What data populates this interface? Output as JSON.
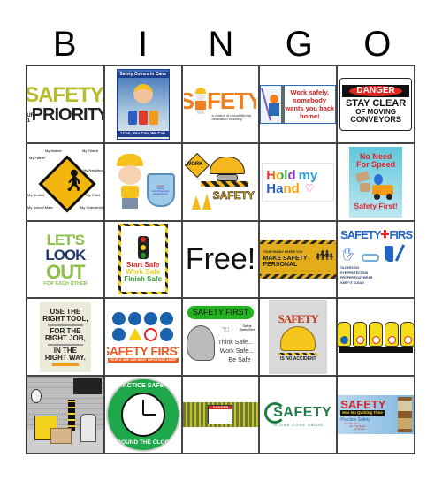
{
  "header": {
    "letters": [
      "B",
      "I",
      "N",
      "G",
      "O"
    ]
  },
  "cells": [
    {
      "id": "safety-our-1-priority",
      "line1": "SAFETY,",
      "prefix": "OUR #1",
      "line2": "PRIORITY",
      "colors": {
        "primary": "#b7bd2a",
        "secondary": "#222222"
      }
    },
    {
      "id": "safety-comes-in-cans",
      "title": "Safety Comes in Cans",
      "caption": "I Can, You Can, We Can",
      "can_labels": [
        "I Can",
        "You Can",
        "We Can"
      ],
      "colors": {
        "bg": "#1d3f8c",
        "accent": "#e03a2d"
      }
    },
    {
      "id": "safety-culture",
      "word_prefix": "S",
      "word_suffix": "FETY",
      "caption": "a culture of unconditional dedication to safety",
      "colors": {
        "primary": "#f07f1e"
      }
    },
    {
      "id": "work-safely-home",
      "text": "Work safely, somebody wants you back home!",
      "colors": {
        "text": "#cc1f1f",
        "border": "#2b6cb8"
      }
    },
    {
      "id": "danger-conveyors",
      "badge": "DANGER",
      "line1": "STAY CLEAR",
      "line2": "OF MOVING",
      "line3": "CONVEYORS",
      "colors": {
        "badge": "#e0241f"
      }
    },
    {
      "id": "pedestrian-sign",
      "labels": [
        "My Mother",
        "My Friend",
        "My Father",
        "My Neighbor",
        "My Brother",
        "My Child",
        "My School Mate",
        "My Grandchild"
      ],
      "colors": {
        "sign": "#f5b50f"
      }
    },
    {
      "id": "worker-shield",
      "shield_lines": [
        "Health",
        "Safety",
        "Fire Protection",
        "Engineering"
      ],
      "colors": {
        "helmet": "#f5c21b",
        "shield": "#9ecbe8"
      }
    },
    {
      "id": "work-safety-barrier",
      "sign": "WORK",
      "word": "SAFETY",
      "colors": {
        "yellow": "#f4b81c"
      }
    },
    {
      "id": "hold-my-hand",
      "line1_a": "Hold",
      "line1_b": "my",
      "line2": "Hand"
    },
    {
      "id": "no-need-for-speed",
      "line1": "No Need",
      "line2": "For Speed",
      "footer": "Safety First!",
      "colors": {
        "bg": "#5ec8db",
        "text": "#e0242b"
      }
    },
    {
      "id": "lets-look-out",
      "line1": "LET'S",
      "line2": "LOOK",
      "line3": "OUT",
      "line4": "FOR EACH OTHER",
      "colors": {
        "green": "#8cc04b",
        "navy": "#1f3a6b"
      }
    },
    {
      "id": "start-work-finish-safe",
      "line1": "Start Safe",
      "line2": "Work Safe",
      "line3": "Finish Safe",
      "colors": {
        "red": "#e0241f",
        "yellow": "#e0cf1b",
        "green": "#2e9a2e"
      }
    },
    {
      "id": "free-space",
      "label": "Free!"
    },
    {
      "id": "make-safety-personal",
      "small": "YOUR FAMILY NEEDS YOU",
      "line1": "MAKE SAFETY",
      "line2": "PERSONAL",
      "colors": {
        "bg": "#e2ac1b"
      }
    },
    {
      "id": "safety-first-ppe",
      "title_a": "SAFETY",
      "title_b": "FIRST.",
      "items": [
        "GLOVES ON",
        "EYE PROTECTION",
        "PROPER FOOTWEAR",
        "KEEP IT CLEAN"
      ],
      "colors": {
        "blue": "#1f64c2",
        "cross": "#e0241f"
      }
    },
    {
      "id": "right-tool-right-job",
      "line1": "USE THE",
      "line2": "RIGHT TOOL,",
      "line3": "FOR THE",
      "line4": "RIGHT JOB,",
      "line5": "IN THE",
      "line6": "RIGHT WAY.",
      "colors": {
        "bg": "#ecebd9"
      }
    },
    {
      "id": "safety-first-people",
      "title": "SAFETY FIRST",
      "banner": "PEOPLE ARE OUR MOST IMPORTANT ASSET",
      "colors": {
        "blue": "#1a62ad",
        "orange": "#f05a1e"
      }
    },
    {
      "id": "think-work-be-safe",
      "title": "SAFETY FIRST",
      "side": "Safety Starts Here",
      "line1": "Think Safe...",
      "line2": "Work Safe...",
      "line3": "Be Safe",
      "colors": {
        "pill": "#22b41f"
      }
    },
    {
      "id": "safety-no-accident",
      "word": "SAFETY",
      "caption": "IS NO ACCIDENT",
      "colors": {
        "bg": "#d9d9d9",
        "helmet": "#f5c61b"
      }
    },
    {
      "id": "stop-hands",
      "count": 5,
      "colors": {
        "hand": "#f5dd1b"
      }
    },
    {
      "id": "warehouse-forklift",
      "colors": {
        "forklift": "#f2d21b",
        "bg": "#cfcfcf"
      }
    },
    {
      "id": "practice-safety-clock",
      "top": "PRACTICE SAFETY",
      "bottom": "AROUND THE CLOCK",
      "colors": {
        "green": "#1fa84a"
      }
    },
    {
      "id": "danger-fence",
      "sign": "DANGER",
      "colors": {
        "fence": "#c9c21b",
        "sign": "#d32b2b"
      }
    },
    {
      "id": "safety-core-value",
      "word": "SAFETY",
      "caption": "IS OUR CORE VALUE",
      "colors": {
        "green": "#1f7a46"
      }
    },
    {
      "id": "safety-no-quitting-time",
      "word": "SAFETY",
      "banner": "Has No Quitting Time",
      "line": "Practice Safety",
      "items": [
        "On The Job",
        "On The Road",
        "At Home"
      ],
      "colors": {
        "red": "#d12b2b",
        "bg": "#7fb6de"
      }
    }
  ]
}
